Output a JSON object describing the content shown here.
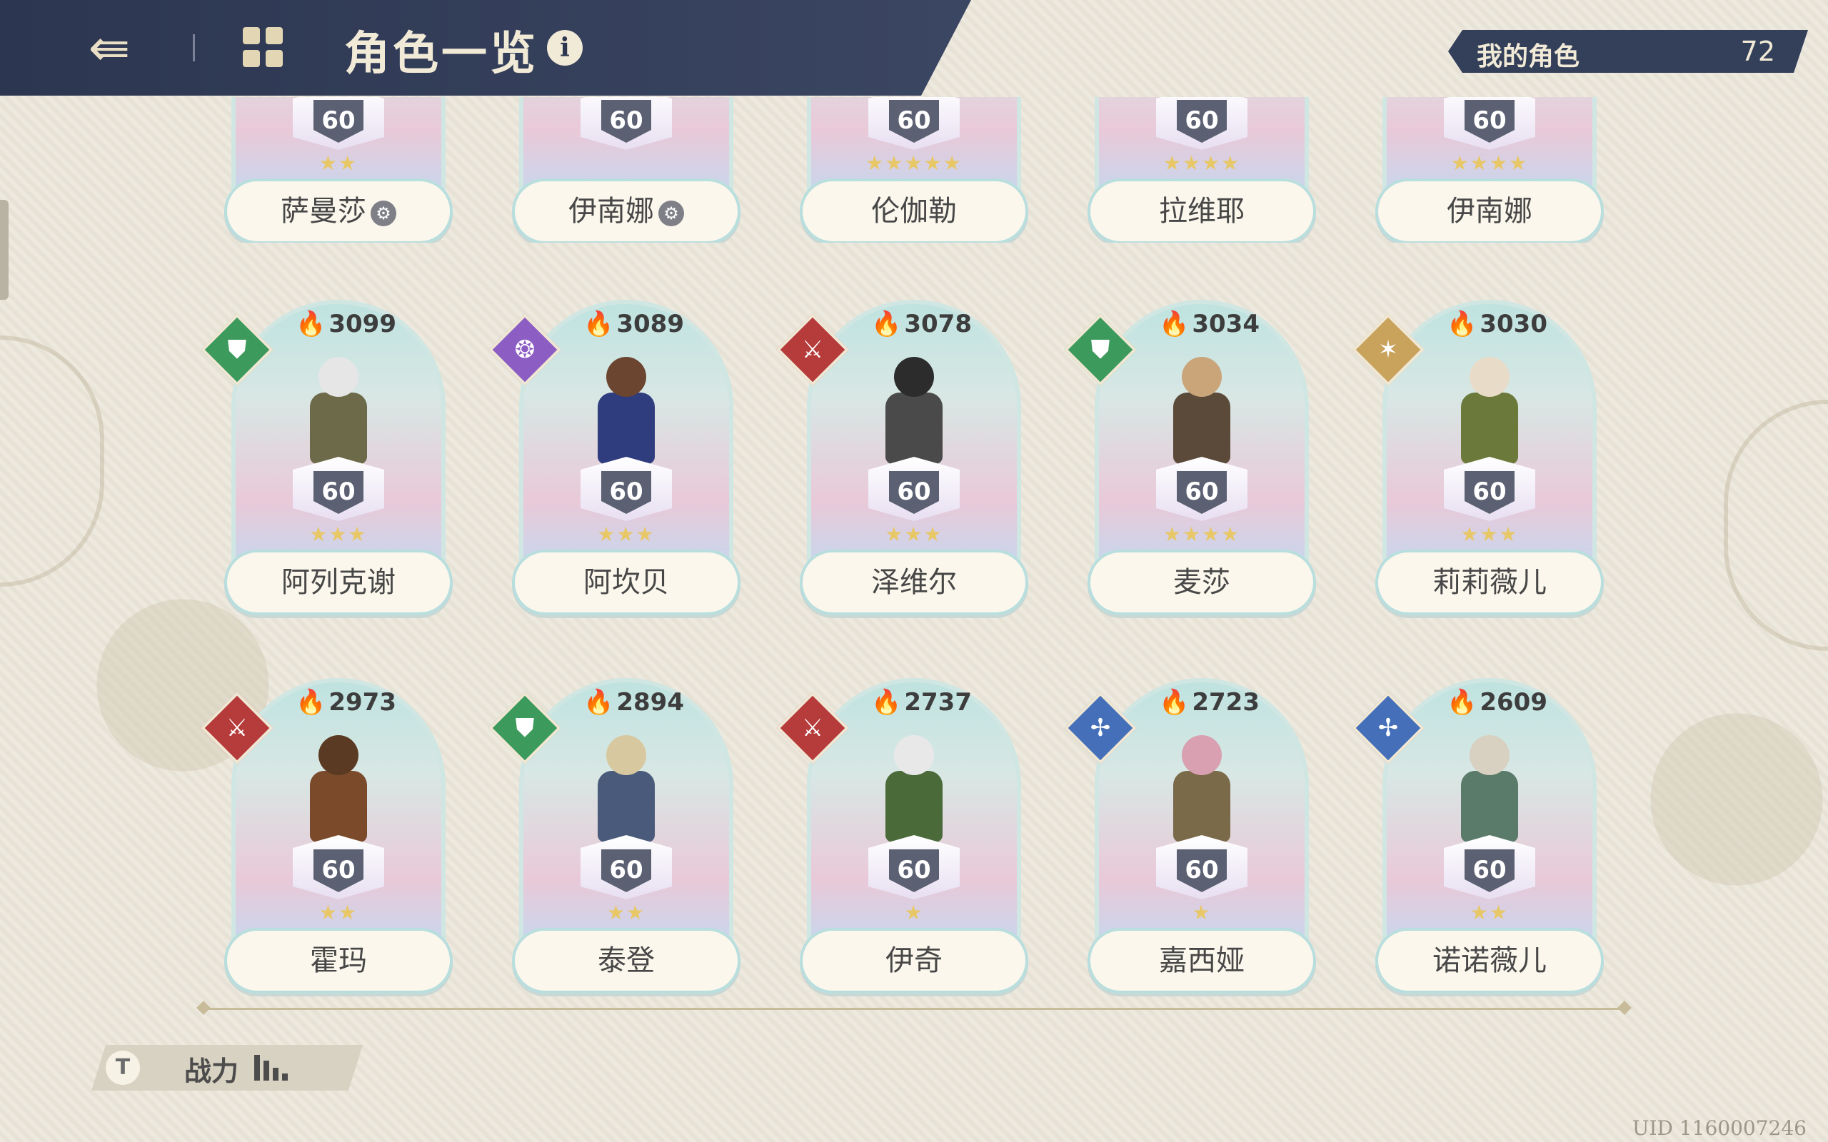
{
  "header": {
    "title": "角色一览",
    "info": "i"
  },
  "roster": {
    "label": "我的角色",
    "count": "72"
  },
  "row0": [
    {
      "name": "萨曼莎",
      "badge": "⚙",
      "level": "60",
      "stars": "★★"
    },
    {
      "name": "伊南娜",
      "badge": "⚙",
      "level": "60",
      "stars": ""
    },
    {
      "name": "伦伽勒",
      "badge": "",
      "level": "60",
      "stars": "★★★★★"
    },
    {
      "name": "拉维耶",
      "badge": "",
      "level": "60",
      "stars": "★★★★"
    },
    {
      "name": "伊南娜",
      "badge": "",
      "level": "60",
      "stars": "★★★★"
    }
  ],
  "row1": [
    {
      "name": "阿列克谢",
      "power": "3099",
      "level": "60",
      "stars": "★★★",
      "element": "green",
      "elem_icon": "⛊"
    },
    {
      "name": "阿坎贝",
      "power": "3089",
      "level": "60",
      "stars": "★★★",
      "element": "purple",
      "elem_icon": "❂"
    },
    {
      "name": "泽维尔",
      "power": "3078",
      "level": "60",
      "stars": "★★★",
      "element": "red",
      "elem_icon": "⚔"
    },
    {
      "name": "麦莎",
      "power": "3034",
      "level": "60",
      "stars": "★★★★",
      "element": "green",
      "elem_icon": "⛊"
    },
    {
      "name": "莉莉薇儿",
      "power": "3030",
      "level": "60",
      "stars": "★★★",
      "element": "gold",
      "elem_icon": "✶"
    }
  ],
  "row2": [
    {
      "name": "霍玛",
      "power": "2973",
      "level": "60",
      "stars": "★★",
      "element": "red",
      "elem_icon": "⚔"
    },
    {
      "name": "泰登",
      "power": "2894",
      "level": "60",
      "stars": "★★",
      "element": "green",
      "elem_icon": "⛊"
    },
    {
      "name": "伊奇",
      "power": "2737",
      "level": "60",
      "stars": "★",
      "element": "red",
      "elem_icon": "⚔"
    },
    {
      "name": "嘉西娅",
      "power": "2723",
      "level": "60",
      "stars": "★",
      "element": "blue",
      "elem_icon": "✢"
    },
    {
      "name": "诺诺薇儿",
      "power": "2609",
      "level": "60",
      "stars": "★★",
      "element": "blue",
      "elem_icon": "✢"
    }
  ],
  "filter": {
    "label": "战力"
  },
  "uid": "UID 1160007246"
}
